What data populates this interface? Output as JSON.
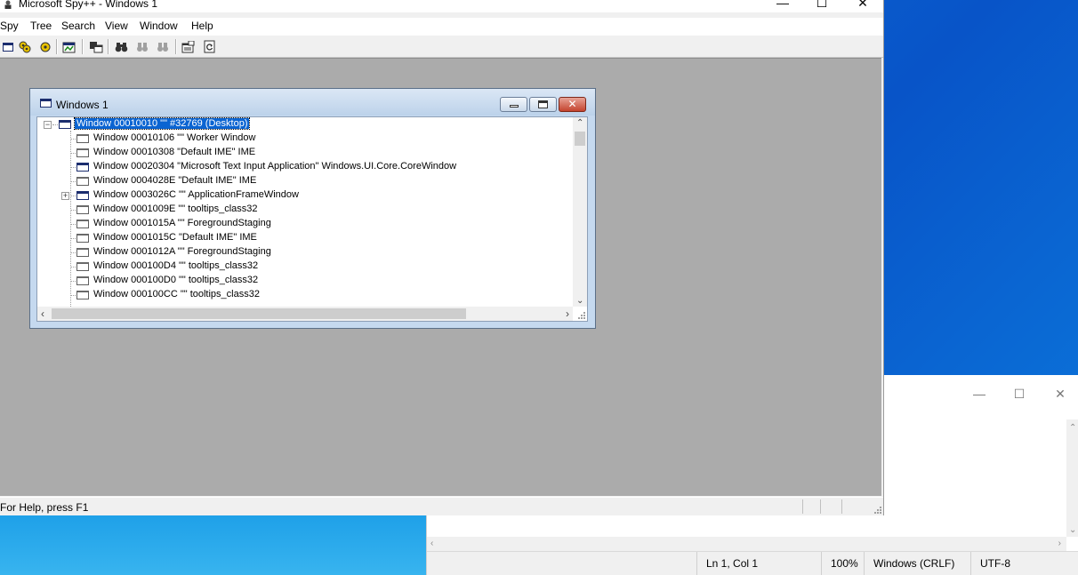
{
  "spy": {
    "title": "Microsoft Spy++ - Windows 1",
    "menu": [
      "Spy",
      "Tree",
      "Search",
      "View",
      "Window",
      "Help"
    ],
    "status": "For Help, press F1"
  },
  "child": {
    "title": "Windows 1",
    "rows": [
      {
        "text": "Window 00010010 \"\" #32769 (Desktop)",
        "selected": true
      },
      {
        "text": "Window 00010106 \"\" Worker Window"
      },
      {
        "text": "Window 00010308 \"Default IME\" IME"
      },
      {
        "text": "Window 00020304 \"Microsoft Text Input Application\" Windows.UI.Core.CoreWindow"
      },
      {
        "text": "Window 0004028E \"Default IME\" IME"
      },
      {
        "text": "Window 0003026C \"\" ApplicationFrameWindow"
      },
      {
        "text": "Window 0001009E \"\" tooltips_class32"
      },
      {
        "text": "Window 0001015A \"\" ForegroundStaging"
      },
      {
        "text": "Window 0001015C \"Default IME\" IME"
      },
      {
        "text": "Window 0001012A \"\" ForegroundStaging"
      },
      {
        "text": "Window 000100D4 \"\" tooltips_class32"
      },
      {
        "text": "Window 000100D0 \"\" tooltips_class32"
      },
      {
        "text": "Window 000100CC \"\" tooltips_class32"
      }
    ]
  },
  "notepad": {
    "status": {
      "position": "Ln 1, Col 1",
      "zoom": "100%",
      "line_endings": "Windows (CRLF)",
      "encoding": "UTF-8"
    }
  }
}
